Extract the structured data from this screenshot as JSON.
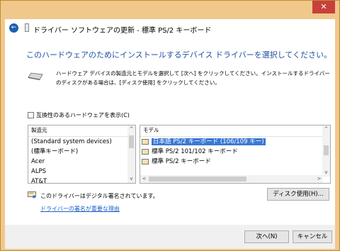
{
  "window": {
    "close_glyph": "✕"
  },
  "nav": {
    "title": "ドライバー ソフトウェアの更新 - 標準 PS/2 キーボード",
    "back_glyph": "←"
  },
  "heading": "このハードウェアのためにインストールするデバイス ドライバーを選択してください。",
  "description": "ハードウェア デバイスの製造元とモデルを選択して [次へ] をクリックしてください。インストールするドライバーのディスクがある場合は、[ディスク使用] をクリックしてください。",
  "compat_checkbox": {
    "label": "互換性のあるハードウェアを表示(C)",
    "checked": false
  },
  "manufacturer_list": {
    "header": "製造元",
    "items": [
      "(Standard system devices)",
      "(標準キーボード)",
      "Acer",
      "ALPS",
      "AT&T"
    ]
  },
  "model_list": {
    "header": "モデル",
    "items": [
      {
        "label": "日本語 PS/2 キーボード (106/109 キー)",
        "selected": true
      },
      {
        "label": "標準 PS/2 101/102 キーボード",
        "selected": false
      },
      {
        "label": "標準 PS/2 キーボード",
        "selected": false
      }
    ]
  },
  "signature": {
    "text": "このドライバーはデジタル署名されています。",
    "link": "ドライバーの署名が重要な理由"
  },
  "buttons": {
    "disk": "ディスク使用(H)...",
    "next": "次へ(N)",
    "cancel": "キャンセル"
  },
  "scroll_glyphs": {
    "up": "^",
    "down": "v",
    "left": "<",
    "right": ">"
  },
  "colors": {
    "frame": "#f1c88c",
    "heading": "#1e4f9f",
    "selection": "#3b78d4",
    "link": "#1e5fc7",
    "close": "#c7403a"
  }
}
